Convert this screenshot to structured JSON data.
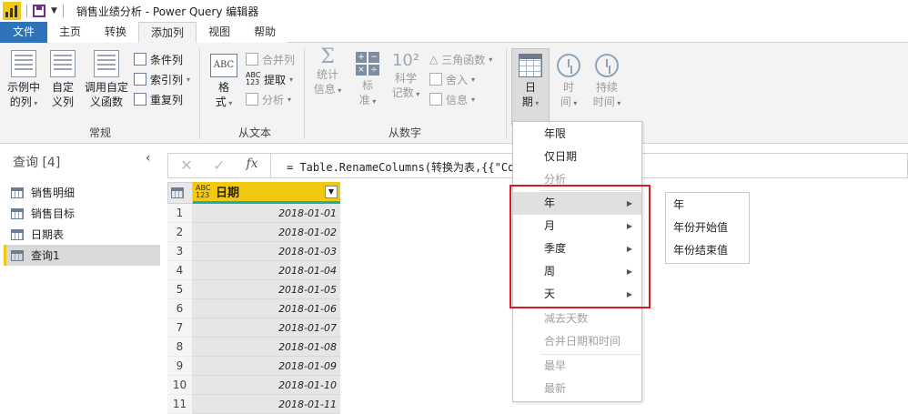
{
  "window": {
    "title": "销售业绩分析 - Power Query 编辑器"
  },
  "tabs": [
    "文件",
    "主页",
    "转换",
    "添加列",
    "视图",
    "帮助"
  ],
  "ribbon": {
    "general": {
      "example_col": [
        "示例中",
        "的列"
      ],
      "custom_col": [
        "自定",
        "义列"
      ],
      "invoke_func": [
        "调用自定",
        "义函数"
      ],
      "conditional": "条件列",
      "index": "索引列",
      "duplicate": "重复列",
      "label": "常规"
    },
    "from_text": {
      "format": [
        "格",
        "式"
      ],
      "merge": "合并列",
      "extract": "提取",
      "parse": "分析",
      "label": "从文本"
    },
    "from_number": {
      "stats": [
        "统计",
        "信息"
      ],
      "standard": [
        "标",
        "准"
      ],
      "scientific": [
        "科学",
        "记数"
      ],
      "trig": "三角函数",
      "round": "舍入",
      "info": "信息",
      "label": "从数字"
    },
    "from_datetime": {
      "date": [
        "日",
        "期"
      ],
      "time": [
        "时",
        "间"
      ],
      "duration": [
        "持续",
        "时间"
      ]
    }
  },
  "queries": {
    "header": "查询 [4]",
    "items": [
      "销售明细",
      "销售目标",
      "日期表",
      "查询1"
    ]
  },
  "formula": {
    "text": "= Table.RenameColumns(转换为表,{{\"Colu",
    "fx": "fx"
  },
  "grid": {
    "type_label": [
      "ABC",
      "123"
    ],
    "column": "日期",
    "rows": [
      {
        "n": "1",
        "v": "2018-01-01"
      },
      {
        "n": "2",
        "v": "2018-01-02"
      },
      {
        "n": "3",
        "v": "2018-01-03"
      },
      {
        "n": "4",
        "v": "2018-01-04"
      },
      {
        "n": "5",
        "v": "2018-01-05"
      },
      {
        "n": "6",
        "v": "2018-01-06"
      },
      {
        "n": "7",
        "v": "2018-01-07"
      },
      {
        "n": "8",
        "v": "2018-01-08"
      },
      {
        "n": "9",
        "v": "2018-01-09"
      },
      {
        "n": "10",
        "v": "2018-01-10"
      },
      {
        "n": "11",
        "v": "2018-01-11"
      }
    ]
  },
  "date_menu": {
    "items": [
      {
        "label": "年限",
        "disabled": false
      },
      {
        "label": "仅日期",
        "disabled": false
      },
      {
        "label": "分析",
        "disabled": true
      },
      {
        "label": "年",
        "submenu": true
      },
      {
        "label": "月",
        "submenu": true
      },
      {
        "label": "季度",
        "submenu": true
      },
      {
        "label": "周",
        "submenu": true
      },
      {
        "label": "天",
        "submenu": true
      },
      {
        "label": "减去天数",
        "disabled": true
      },
      {
        "label": "合并日期和时间",
        "disabled": true
      },
      {
        "label": "最早",
        "disabled": true
      },
      {
        "label": "最新",
        "disabled": true
      }
    ]
  },
  "year_submenu": [
    "年",
    "年份开始值",
    "年份结束值"
  ],
  "colors": {
    "accent_yellow": "#f2c811",
    "file_tab": "#2e72b8",
    "highlight_box": "#e0191f",
    "column_underline": "#1ab1a0"
  }
}
